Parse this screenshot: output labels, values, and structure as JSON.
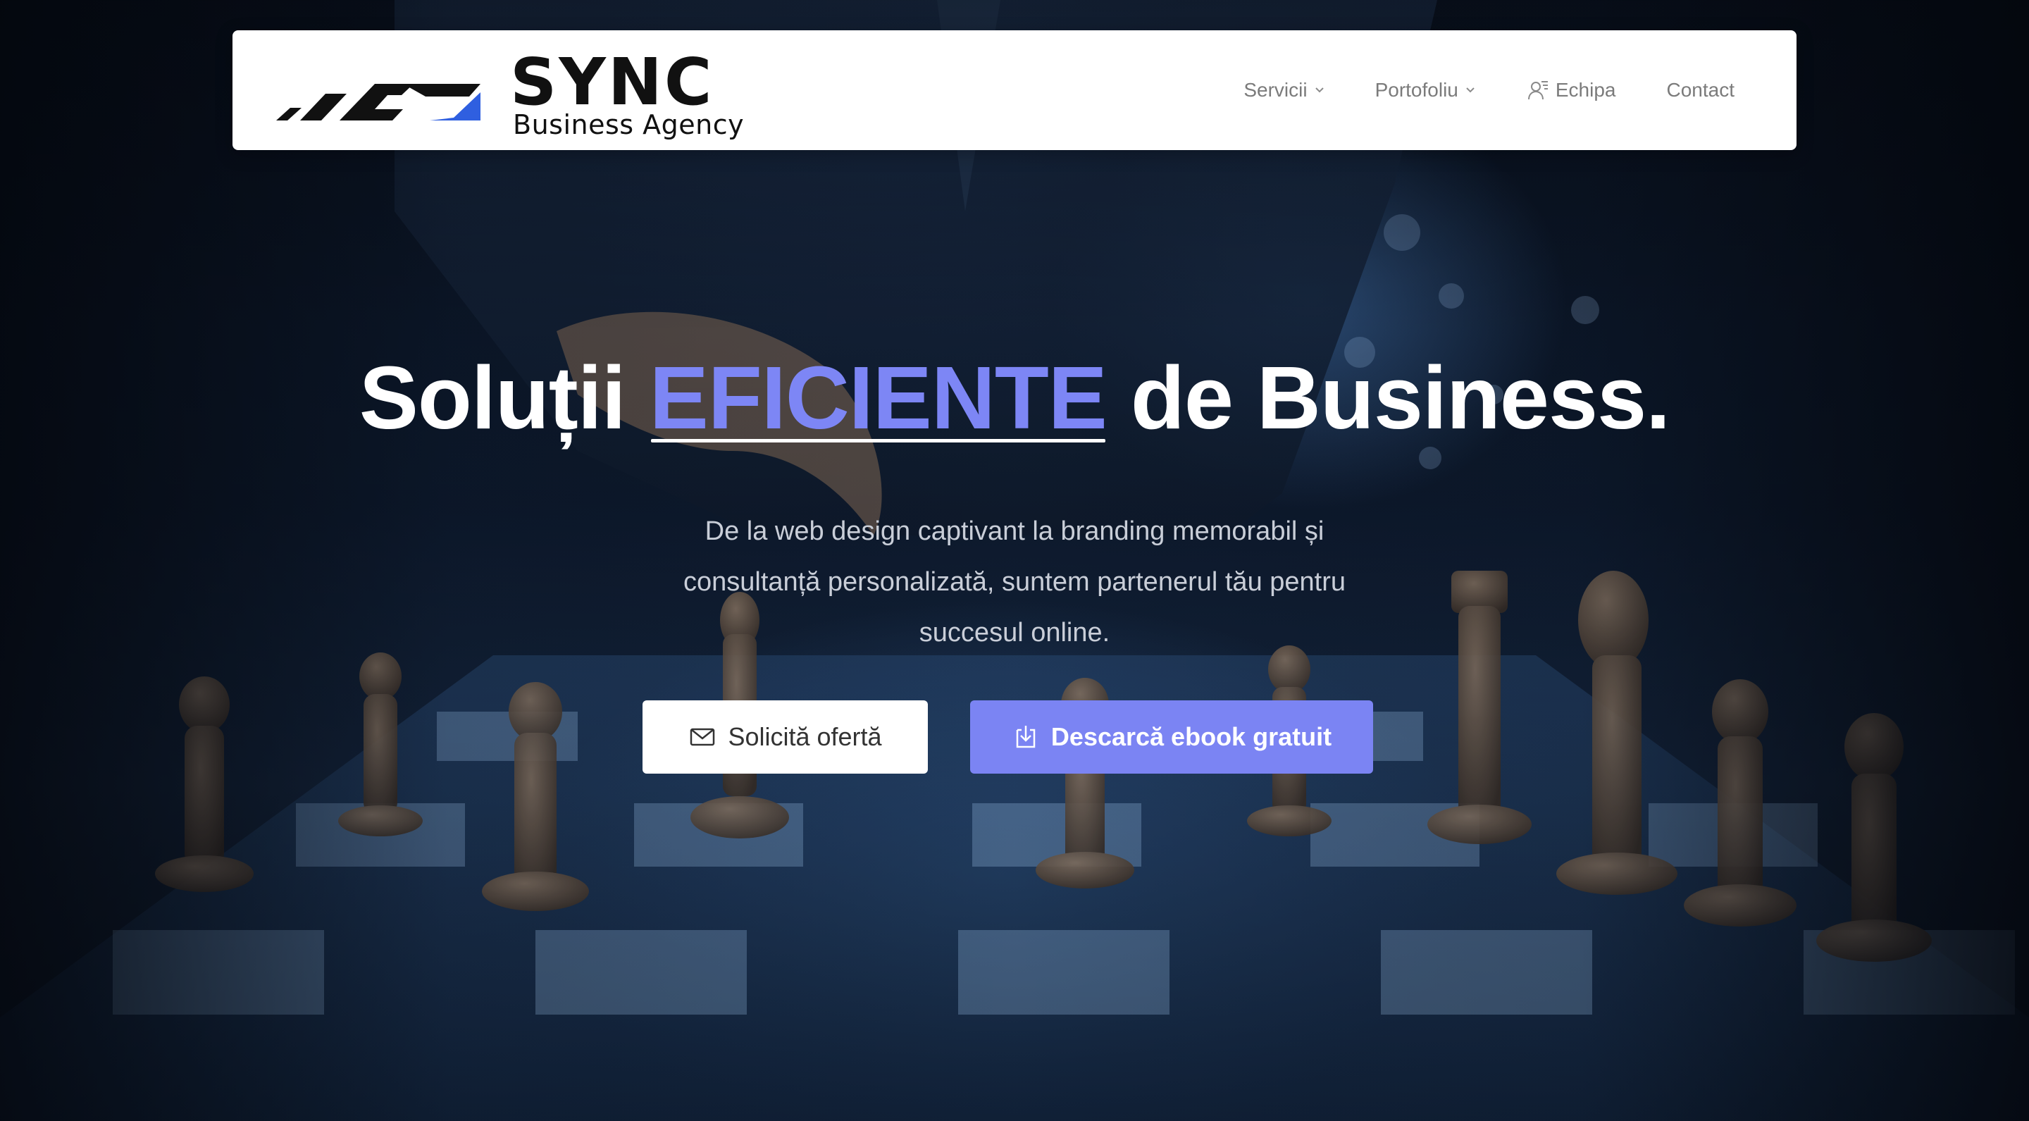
{
  "brand": {
    "name": "SYNC",
    "tagline": "Business Agency",
    "logo_icon": "sync-logo-mark-icon",
    "accent_color": "#2f5fe0"
  },
  "nav": {
    "items": [
      {
        "label": "Servicii",
        "icon": "chevron-down-icon"
      },
      {
        "label": "Portofoliu",
        "icon": "chevron-down-icon"
      },
      {
        "label": "Echipa",
        "icon": "team-user-icon"
      },
      {
        "label": "Contact"
      }
    ]
  },
  "hero": {
    "headline_start": "Soluții",
    "headline_accent": "EFICIENTE",
    "headline_end": "de Business.",
    "accent_color": "#7d86f5",
    "subtext": "De la web design captivant la branding memorabil și consultanță personalizată, suntem partenerul tău pentru succesul online.",
    "buttons": {
      "offer_label": "Solicită ofertă",
      "offer_icon": "mail-icon",
      "ebook_label": "Descarcă ebook gratuit",
      "ebook_icon": "download-icon",
      "ebook_color": "#7b84f3"
    }
  }
}
